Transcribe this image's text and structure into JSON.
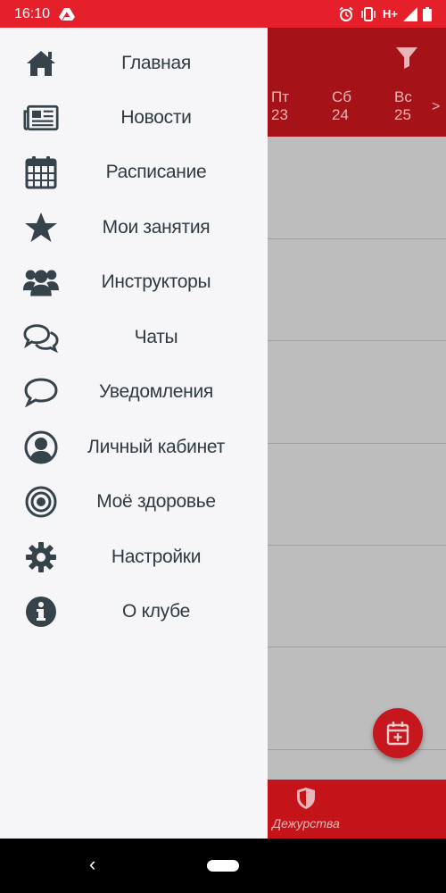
{
  "status_bar": {
    "time": "16:10",
    "network": "H+"
  },
  "app": {
    "days": [
      {
        "name": "Пт",
        "date": "23"
      },
      {
        "name": "Сб",
        "date": "24"
      },
      {
        "name": "Вс",
        "date": "25"
      }
    ],
    "next_label": ">",
    "bottom_nav": {
      "item_label": "Дежурства"
    },
    "colors": {
      "header": "#a51218",
      "status_bar": "#e5202b",
      "accent": "#c6171e"
    }
  },
  "drawer": {
    "items": [
      {
        "label": "Главная",
        "icon": "home-icon"
      },
      {
        "label": "Новости",
        "icon": "news-icon"
      },
      {
        "label": "Расписание",
        "icon": "calendar-icon"
      },
      {
        "label": "Мои занятия",
        "icon": "star-icon"
      },
      {
        "label": "Инструкторы",
        "icon": "users-icon"
      },
      {
        "label": "Чаты",
        "icon": "chats-icon"
      },
      {
        "label": "Уведомления",
        "icon": "comment-icon"
      },
      {
        "label": "Личный кабинет",
        "icon": "user-circle-icon"
      },
      {
        "label": "Моё здоровье",
        "icon": "target-icon"
      },
      {
        "label": "Настройки",
        "icon": "gear-icon"
      },
      {
        "label": "О клубе",
        "icon": "info-icon"
      }
    ]
  },
  "system_nav": {
    "back": "‹"
  }
}
